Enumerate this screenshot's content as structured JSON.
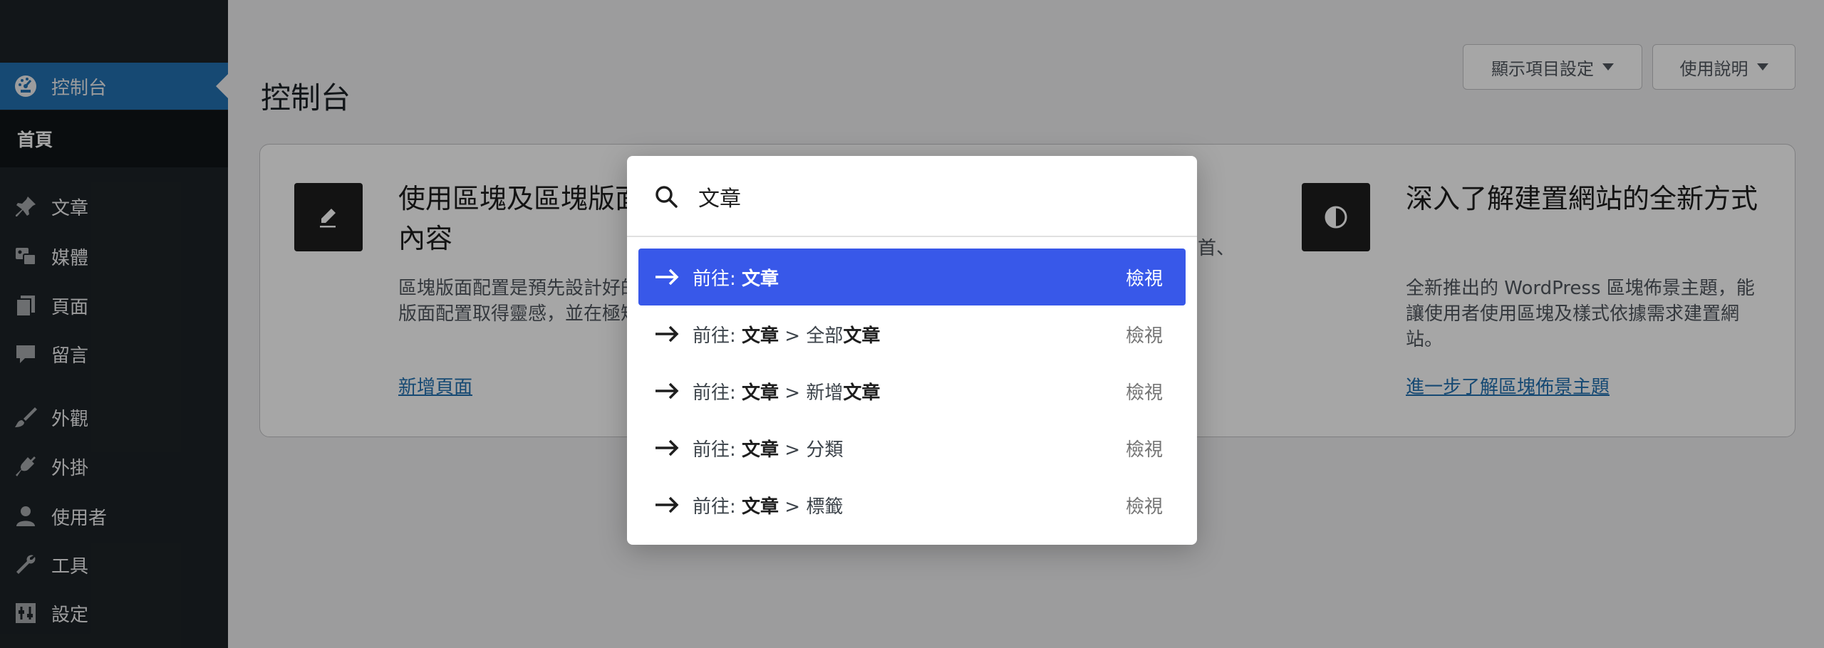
{
  "sidebar": {
    "dashboard": "控制台",
    "home": "首頁",
    "items": [
      {
        "label": "文章",
        "icon": "pin-icon"
      },
      {
        "label": "媒體",
        "icon": "media-icon"
      },
      {
        "label": "頁面",
        "icon": "pages-icon"
      },
      {
        "label": "留言",
        "icon": "comment-icon"
      },
      {
        "label": "外觀",
        "icon": "brush-icon"
      },
      {
        "label": "外掛",
        "icon": "plugin-icon"
      },
      {
        "label": "使用者",
        "icon": "user-icon"
      },
      {
        "label": "工具",
        "icon": "wrench-icon"
      },
      {
        "label": "設定",
        "icon": "settings-icon"
      }
    ]
  },
  "main": {
    "title": "控制台",
    "screen_options": "顯示項目設定",
    "help": "使用說明"
  },
  "welcome": {
    "card1": {
      "title": "使用區塊及區塊版面配置製作豐富的內容",
      "text": "區塊版面配置是預先設計好的區塊排版樣式。使用區塊版面配置取得靈感，並在極短時間內建立全新頁面。",
      "link": "新增頁面"
    },
    "card2": {
      "text": "首、"
    },
    "card3": {
      "title": "深入了解建置網站的全新方式",
      "text": "全新推出的 WordPress 區塊佈景主題，能讓使用者使用區塊及樣式依據需求建置網站。",
      "link": "進一步了解區塊佈景主題"
    }
  },
  "palette": {
    "query": "文章",
    "view_label": "檢視",
    "results": [
      {
        "prefix": "前往: ",
        "bold1": "文章",
        "sep": "",
        "rest": "",
        "bold2": ""
      },
      {
        "prefix": "前往: ",
        "bold1": "文章",
        "sep": " > 全部",
        "rest": "",
        "bold2": "文章"
      },
      {
        "prefix": "前往: ",
        "bold1": "文章",
        "sep": " > 新增",
        "rest": "",
        "bold2": "文章"
      },
      {
        "prefix": "前往: ",
        "bold1": "文章",
        "sep": " > 分類",
        "rest": "",
        "bold2": ""
      },
      {
        "prefix": "前往: ",
        "bold1": "文章",
        "sep": " > 標籤",
        "rest": "",
        "bold2": ""
      }
    ]
  },
  "colors": {
    "sidebar_bg": "#1d2327",
    "active_bg": "#2271b1",
    "palette_selected": "#3858e9",
    "link": "#2271b1"
  }
}
